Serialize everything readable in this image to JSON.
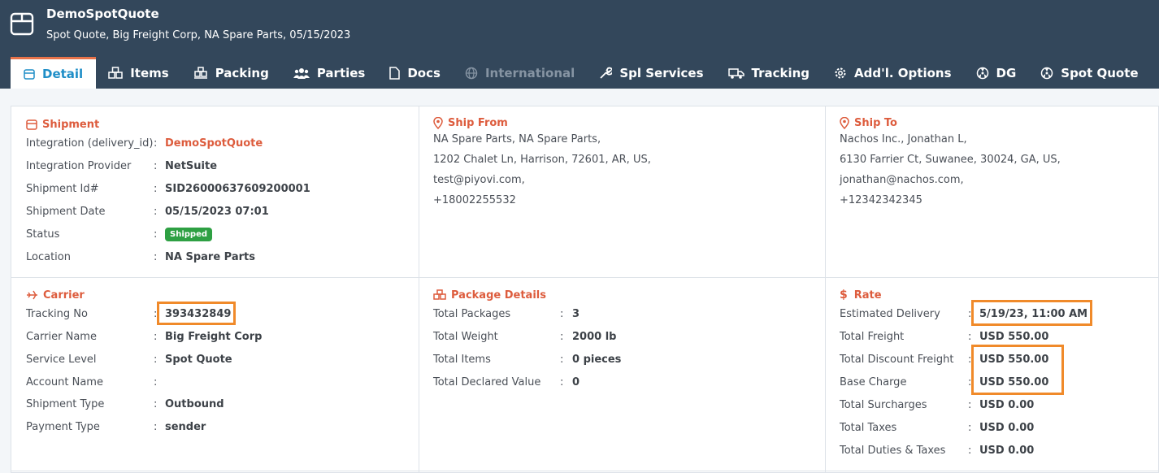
{
  "app": {
    "title": "DemoSpotQuote",
    "subtitle": "Spot Quote, Big Freight Corp, NA Spare Parts, 05/15/2023"
  },
  "tabs": [
    {
      "label": "Detail",
      "icon": "calendar-icon",
      "active": true
    },
    {
      "label": "Items",
      "icon": "boxes-icon"
    },
    {
      "label": "Packing",
      "icon": "pallet-icon"
    },
    {
      "label": "Parties",
      "icon": "users-icon"
    },
    {
      "label": "Docs",
      "icon": "document-icon"
    },
    {
      "label": "International",
      "icon": "globe-icon",
      "disabled": true
    },
    {
      "label": "Spl Services",
      "icon": "wrench-icon"
    },
    {
      "label": "Tracking",
      "icon": "truck-icon"
    },
    {
      "label": "Add'l. Options",
      "icon": "gear-icon"
    },
    {
      "label": "DG",
      "icon": "hazard-icon"
    },
    {
      "label": "Spot Quote",
      "icon": "hazard-icon"
    }
  ],
  "shipment": {
    "title": "Shipment",
    "rows": [
      {
        "label": "Integration (delivery_id)",
        "value": "DemoSpotQuote"
      },
      {
        "label": "Integration Provider",
        "value": "NetSuite"
      },
      {
        "label": "Shipment Id#",
        "value": "SID26000637609200001"
      },
      {
        "label": "Shipment Date",
        "value": "05/15/2023 07:01"
      },
      {
        "label": "Status",
        "value": "Shipped"
      },
      {
        "label": "Location",
        "value": "NA Spare Parts"
      }
    ]
  },
  "ship_from": {
    "title": "Ship From",
    "lines": [
      "NA Spare Parts, NA Spare Parts,",
      "1202 Chalet Ln, Harrison, 72601, AR, US,",
      "test@piyovi.com,",
      "+18002255532"
    ]
  },
  "ship_to": {
    "title": "Ship To",
    "lines": [
      "Nachos Inc., Jonathan L,",
      "6130 Farrier Ct, Suwanee, 30024, GA, US,",
      "jonathan@nachos.com,",
      "+12342342345"
    ]
  },
  "carrier": {
    "title": "Carrier",
    "rows": [
      {
        "label": "Tracking No",
        "value": "393432849"
      },
      {
        "label": "Carrier Name",
        "value": "Big Freight Corp"
      },
      {
        "label": "Service Level",
        "value": "Spot Quote"
      },
      {
        "label": "Account Name",
        "value": ""
      },
      {
        "label": "Shipment Type",
        "value": "Outbound"
      },
      {
        "label": "Payment Type",
        "value": "sender"
      }
    ]
  },
  "package": {
    "title": "Package Details",
    "rows": [
      {
        "label": "Total Packages",
        "value": "3"
      },
      {
        "label": "Total Weight",
        "value": "2000 lb"
      },
      {
        "label": "Total Items",
        "value": "0 pieces"
      },
      {
        "label": "Total Declared Value",
        "value": "0"
      }
    ]
  },
  "rate": {
    "title": "Rate",
    "rows": [
      {
        "label": "Estimated Delivery",
        "value": "5/19/23, 11:00 AM"
      },
      {
        "label": "Total Freight",
        "value": "USD 550.00"
      },
      {
        "label": "Total Discount Freight",
        "value": "USD 550.00"
      },
      {
        "label": "Base Charge",
        "value": "USD 550.00"
      },
      {
        "label": "Total Surcharges",
        "value": "USD 0.00"
      },
      {
        "label": "Total Taxes",
        "value": "USD 0.00"
      },
      {
        "label": "Total Duties & Taxes",
        "value": "USD 0.00"
      }
    ]
  },
  "colors": {
    "header": "#33475b",
    "accent": "#dd5c3d",
    "active_tab_text": "#1f8ec7",
    "status_badge": "#2ea043",
    "highlight": "#f08a2a"
  }
}
